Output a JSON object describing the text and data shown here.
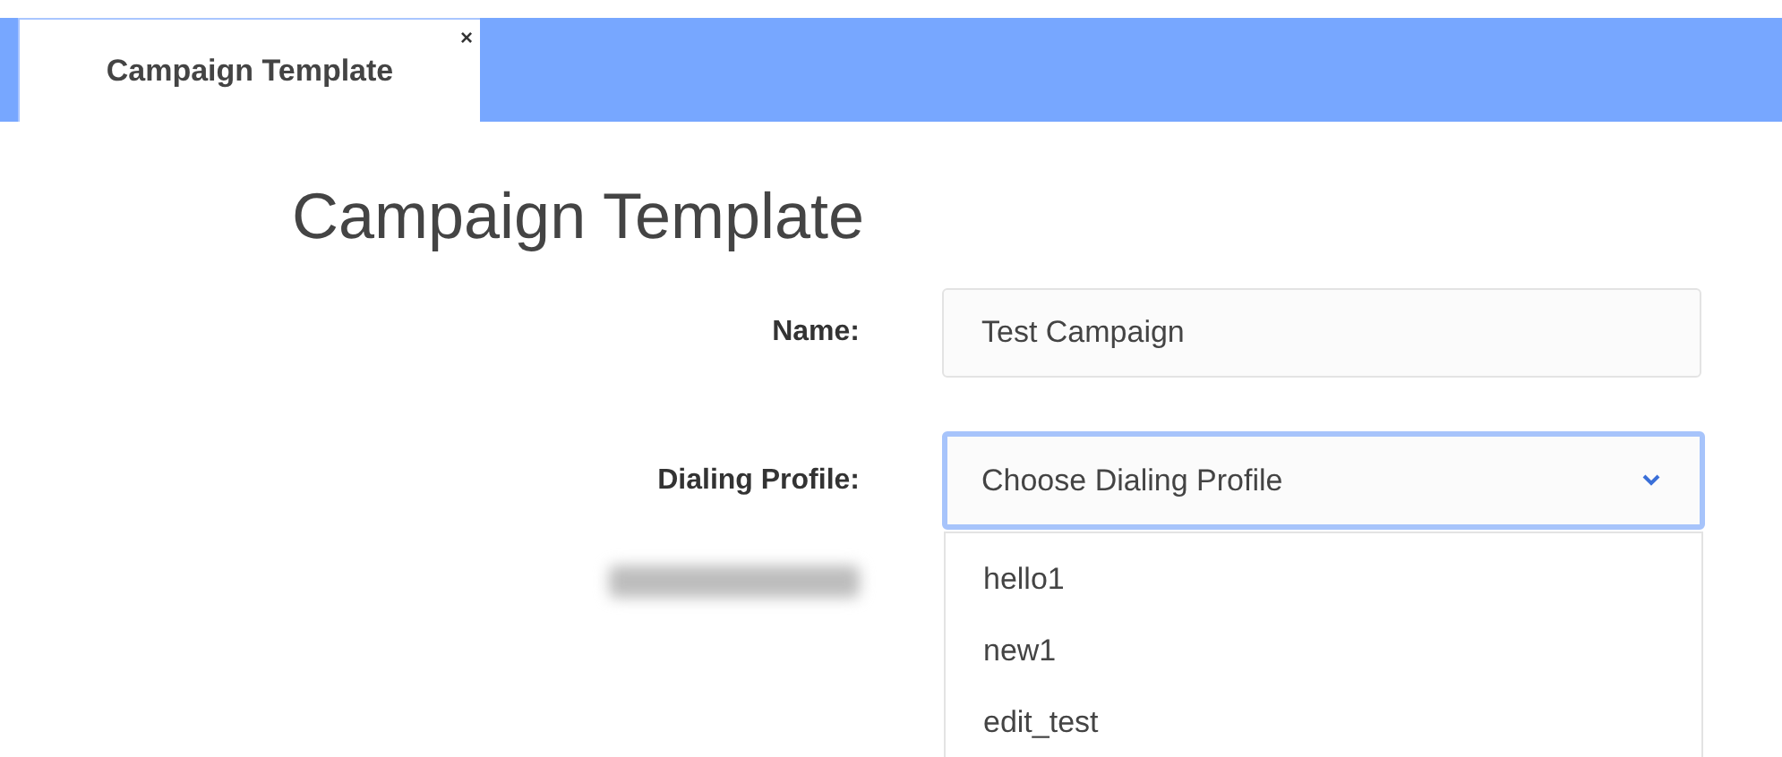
{
  "tabs": [
    {
      "label": "Campaign Template",
      "selected": true,
      "close": "×"
    }
  ],
  "title": "Campaign Template",
  "fields": [
    {
      "label": "Name:",
      "kind": "text",
      "value": "Test Campaign"
    },
    {
      "label": "Dialing Profile:",
      "kind": "select",
      "placeholder": "Choose Dialing Profile",
      "expanded": true,
      "options": [
        "hello1",
        "new1",
        "edit_test"
      ]
    }
  ]
}
